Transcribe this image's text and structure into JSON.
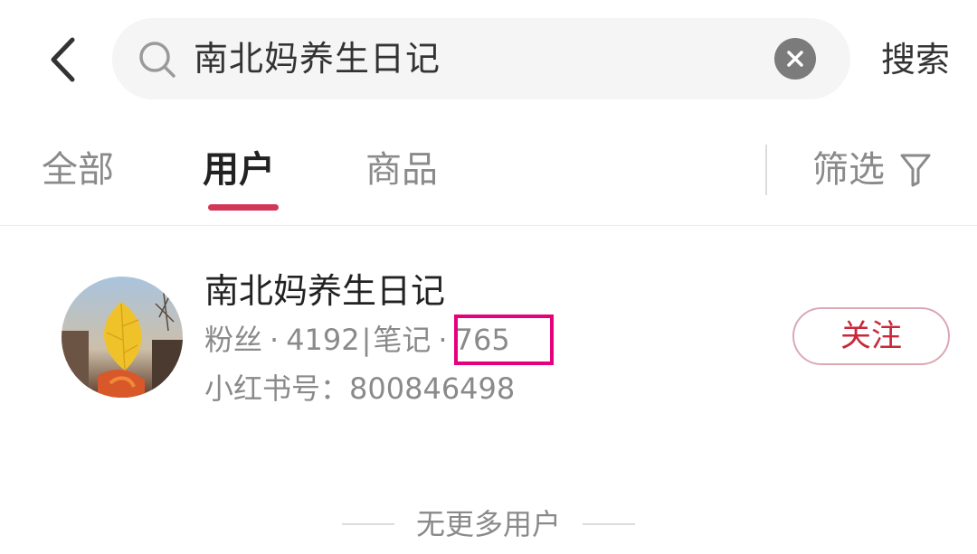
{
  "header": {
    "search_query": "南北妈养生日记",
    "search_button_label": "搜索"
  },
  "tabs": [
    {
      "label": "全部",
      "active": false
    },
    {
      "label": "用户",
      "active": true
    },
    {
      "label": "商品",
      "active": false
    }
  ],
  "filter": {
    "label": "筛选"
  },
  "user_card": {
    "name": "南北妈养生日记",
    "fans_label": "粉丝",
    "fans_count": "4192",
    "notes_label": "笔记",
    "notes_count": "765",
    "red_id_label": "小红书号：",
    "red_id": "800846498",
    "follow_label": "关注"
  },
  "footer": {
    "no_more_label": "无更多用户"
  },
  "colors": {
    "accent": "#d2375a",
    "follow_text": "#c8283a",
    "highlight_box": "#e5007e"
  },
  "icons": [
    "back-arrow-icon",
    "search-icon",
    "clear-icon",
    "filter-icon"
  ]
}
